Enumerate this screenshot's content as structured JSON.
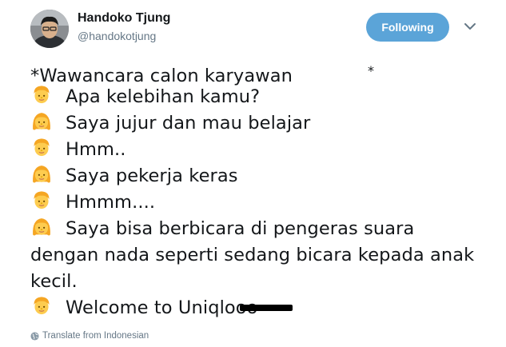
{
  "header": {
    "display_name": "Handoko Tjung",
    "username": "@handokotjung",
    "follow_button_label": "Following",
    "avatar_icon": "user-avatar-photo",
    "more_icon": "chevron-down-icon"
  },
  "tweet": {
    "line1_prefix": "*Wawancara calon karyawan",
    "line1_suffix": "*",
    "lines": [
      {
        "speaker": "man",
        "text": "Apa kelebihan kamu?"
      },
      {
        "speaker": "woman",
        "text": "Saya jujur dan mau belajar"
      },
      {
        "speaker": "man",
        "text": "Hmm.."
      },
      {
        "speaker": "woman",
        "text": "Saya pekerja keras"
      },
      {
        "speaker": "man",
        "text": "Hmmm...."
      },
      {
        "speaker": "woman",
        "text": "Saya bisa berbicara di pengeras suara dengan nada seperti sedang bicara kepada anak kecil."
      },
      {
        "speaker": "man",
        "text": "Welcome to Uniqlooo"
      }
    ]
  },
  "footer": {
    "translate_label": "Translate from Indonesian",
    "translate_icon": "globe-icon"
  },
  "colors": {
    "follow_button_bg": "#5ba4d8",
    "secondary_text": "#657786",
    "emoji_skin": "#fdcc4f",
    "emoji_hair": "#f5a623"
  }
}
